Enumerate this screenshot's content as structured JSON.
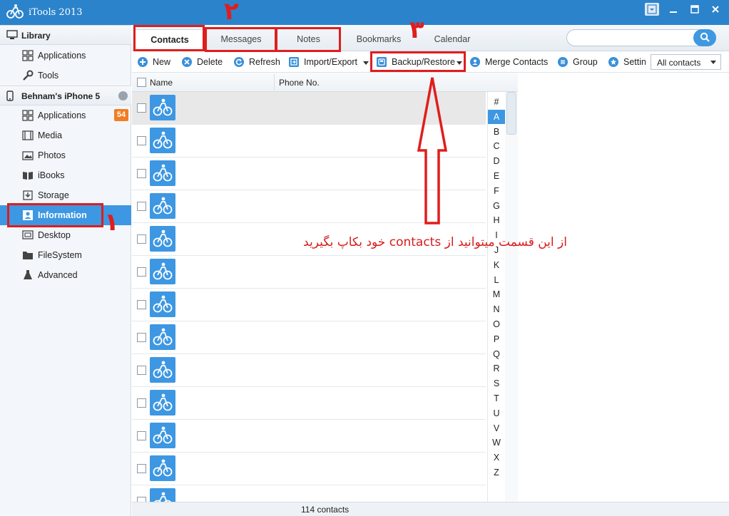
{
  "window": {
    "title": "iTools 2013"
  },
  "sidebar": {
    "library": {
      "label": "Library",
      "items": [
        {
          "label": "Applications",
          "icon": "grid-icon"
        },
        {
          "label": "Tools",
          "icon": "wrench-icon"
        }
      ]
    },
    "device": {
      "label": "Behnam's iPhone 5",
      "items": [
        {
          "label": "Applications",
          "icon": "grid-icon",
          "badge": "54"
        },
        {
          "label": "Media",
          "icon": "film-icon"
        },
        {
          "label": "Photos",
          "icon": "photo-icon"
        },
        {
          "label": "iBooks",
          "icon": "book-icon"
        },
        {
          "label": "Storage",
          "icon": "storage-icon"
        },
        {
          "label": "Information",
          "icon": "contact-card-icon",
          "active": true
        },
        {
          "label": "Desktop",
          "icon": "desktop-icon"
        },
        {
          "label": "FileSystem",
          "icon": "folder-icon"
        },
        {
          "label": "Advanced",
          "icon": "flask-icon"
        }
      ]
    }
  },
  "tabs": [
    {
      "label": "Contacts",
      "active": true
    },
    {
      "label": "Messages"
    },
    {
      "label": "Notes"
    },
    {
      "label": "Bookmarks"
    },
    {
      "label": "Calendar"
    }
  ],
  "search": {
    "placeholder": "",
    "value": ""
  },
  "toolbar": {
    "new": "New",
    "delete": "Delete",
    "refresh": "Refresh",
    "import_export": "Import/Export",
    "backup_restore": "Backup/Restore",
    "merge": "Merge Contacts",
    "group": "Group",
    "settings": "Settin",
    "filter_selected": "All contacts"
  },
  "table": {
    "headers": {
      "name": "Name",
      "phone": "Phone No."
    },
    "rows": [
      {
        "name": "",
        "phone": ""
      },
      {
        "name": "",
        "phone": ""
      },
      {
        "name": "",
        "phone": ""
      },
      {
        "name": "",
        "phone": ""
      },
      {
        "name": "",
        "phone": ""
      },
      {
        "name": "",
        "phone": ""
      },
      {
        "name": "",
        "phone": ""
      },
      {
        "name": "",
        "phone": ""
      },
      {
        "name": "",
        "phone": ""
      },
      {
        "name": "",
        "phone": ""
      },
      {
        "name": "",
        "phone": ""
      },
      {
        "name": "",
        "phone": ""
      },
      {
        "name": "",
        "phone": ""
      }
    ]
  },
  "alphabet": [
    "#",
    "A",
    "B",
    "C",
    "D",
    "E",
    "F",
    "G",
    "H",
    "I",
    "J",
    "K",
    "L",
    "M",
    "N",
    "O",
    "P",
    "Q",
    "R",
    "S",
    "T",
    "U",
    "V",
    "W",
    "X",
    "Z"
  ],
  "alphabet_active": "A",
  "status": {
    "count": "114 contacts"
  },
  "annotations": {
    "marker_1": "۱",
    "marker_2": "۲",
    "marker_3": "۳",
    "note": "از این قسمت میتوانید از contacts خود بکاپ بگیرید"
  },
  "colors": {
    "accent": "#3d97e2",
    "titlebar": "#2b83cc",
    "badge": "#f37d22",
    "annotation_red": "#e01d1d"
  }
}
